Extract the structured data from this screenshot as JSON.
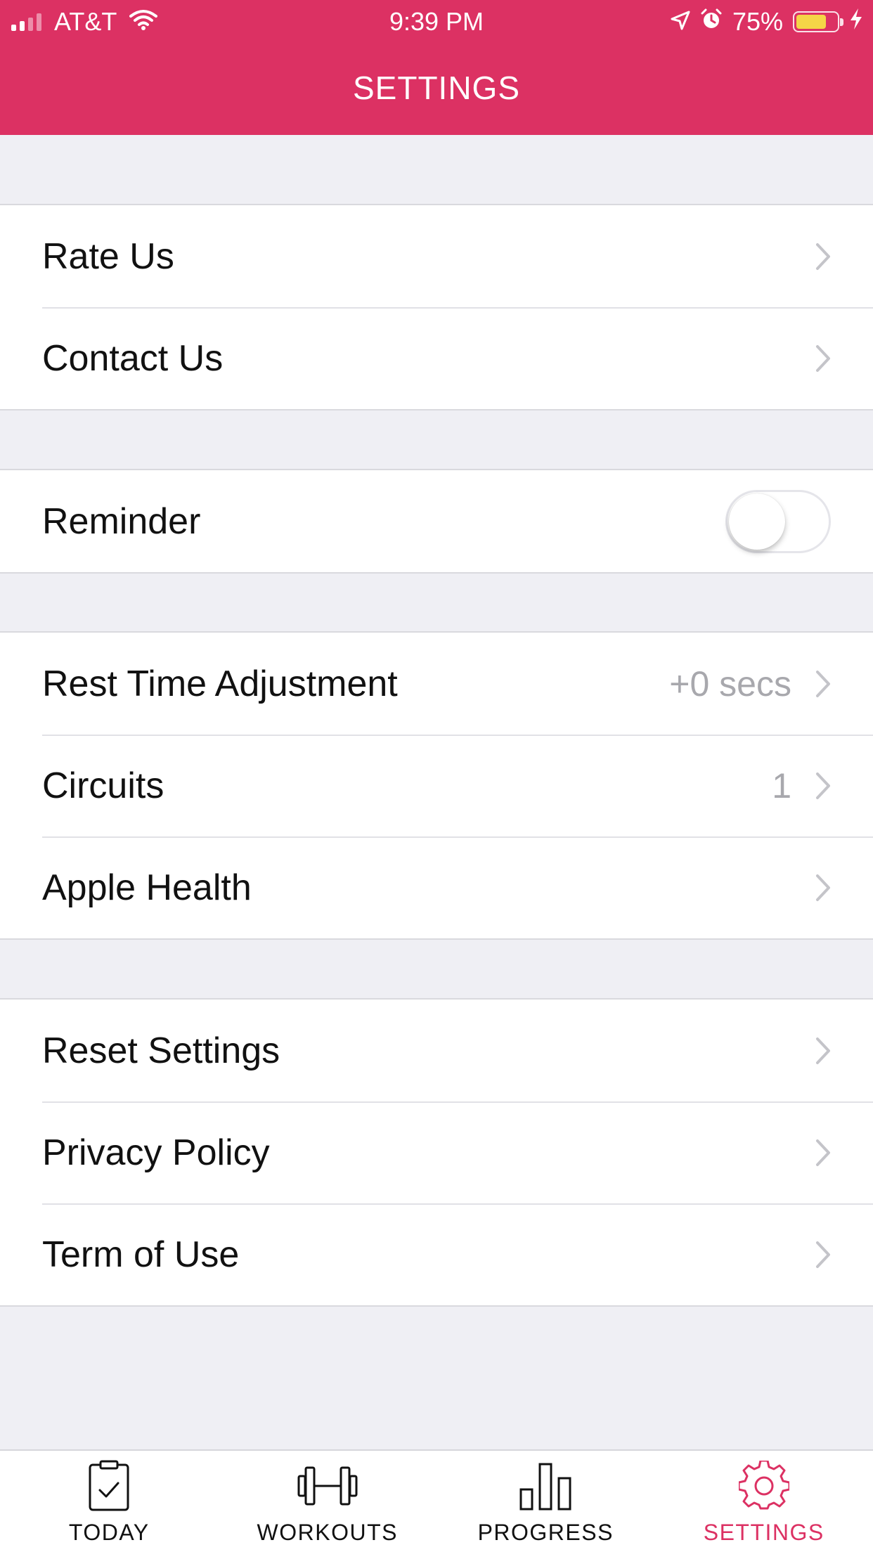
{
  "status_bar": {
    "carrier": "AT&T",
    "time": "9:39 PM",
    "battery_percent": "75%",
    "battery_level": 0.75,
    "icons": [
      "signal-icon",
      "wifi-icon",
      "location-icon",
      "alarm-icon",
      "battery-icon",
      "charging-icon"
    ]
  },
  "nav": {
    "title": "SETTINGS"
  },
  "colors": {
    "accent": "#dc3163",
    "battery_fill": "#f5d547",
    "background": "#efeff4"
  },
  "groups": {
    "feedback": {
      "rate": "Rate Us",
      "contact": "Contact Us"
    },
    "reminder": {
      "label": "Reminder",
      "enabled": false
    },
    "workout": {
      "rest_time": "Rest Time Adjustment",
      "rest_time_value": "+0 secs",
      "circuits": "Circuits",
      "circuits_value": "1",
      "apple_health": "Apple Health"
    },
    "about": {
      "reset": "Reset Settings",
      "privacy": "Privacy Policy",
      "terms": "Term of Use"
    }
  },
  "tabbar": {
    "today": "TODAY",
    "workouts": "WORKOUTS",
    "progress": "PROGRESS",
    "settings": "SETTINGS",
    "active": "settings"
  }
}
